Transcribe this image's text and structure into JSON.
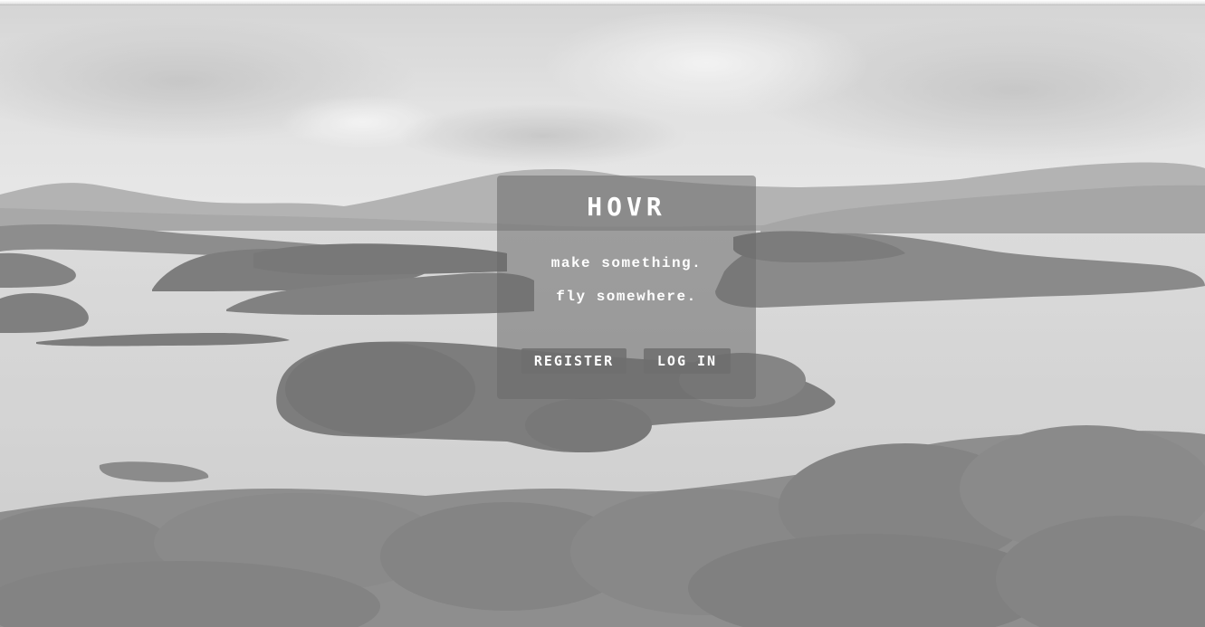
{
  "brand": {
    "name": "HOVR"
  },
  "hero": {
    "tagline_line1": "make something.",
    "tagline_line2": "fly somewhere."
  },
  "actions": {
    "register_label": "REGISTER",
    "login_label": "LOG IN"
  },
  "colors": {
    "card_overlay": "#696969",
    "text": "#ffffff",
    "button_bg": "#6e6e6e"
  }
}
